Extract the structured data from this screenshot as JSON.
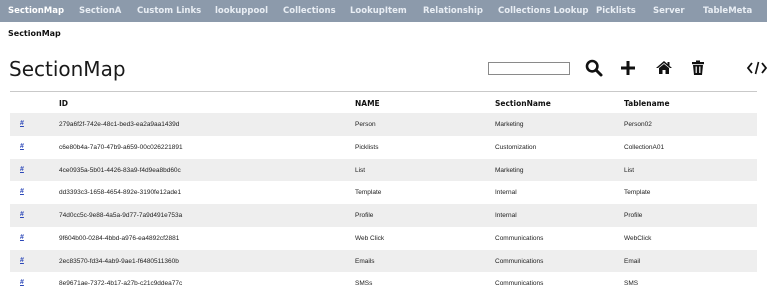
{
  "nav": {
    "items": [
      {
        "label": "SectionMap",
        "active": true
      },
      {
        "label": "SectionA",
        "active": false
      },
      {
        "label": "Custom Links",
        "active": false
      },
      {
        "label": "lookuppool",
        "active": false
      },
      {
        "label": "Collections",
        "active": false
      },
      {
        "label": "LookupItem",
        "active": false
      },
      {
        "label": "Relationship",
        "active": false
      },
      {
        "label": "Collections Lookup",
        "active": false
      },
      {
        "label": "Picklists",
        "active": false
      },
      {
        "label": "Server",
        "active": false
      },
      {
        "label": "TableMeta",
        "active": false
      }
    ]
  },
  "breadcrumb": "SectionMap",
  "page_title": "SectionMap",
  "search": {
    "value": "",
    "placeholder": ""
  },
  "toolbar": {
    "search_icon": "search-icon",
    "add_icon": "plus-icon",
    "home_icon": "home-icon",
    "delete_icon": "trash-icon",
    "code_icon": "code-icon"
  },
  "table": {
    "columns": [
      "",
      "ID",
      "NAME",
      "SectionName",
      "Tablename"
    ],
    "rows": [
      [
        "#",
        "279a6f2f-742e-48c1-bed3-ea2a9aa1439d",
        "Person",
        "Marketing",
        "Person02"
      ],
      [
        "#",
        "c6e80b4a-7a70-47b9-a659-00c026221891",
        "Picklists",
        "Customization",
        "CollectionA01"
      ],
      [
        "#",
        "4ce0935a-5b01-4426-83a9-f4d9ea8bd60c",
        "List",
        "Marketing",
        "List"
      ],
      [
        "#",
        "dd3393c3-1658-4654-892e-3190fe12ade1",
        "Template",
        "Internal",
        "Template"
      ],
      [
        "#",
        "74d0cc5c-9e88-4a5a-9d77-7a9d491e753a",
        "Profile",
        "Internal",
        "Profile"
      ],
      [
        "#",
        "9f604b00-0284-4bbd-a976-ea4892cf2881",
        "Web Click",
        "Communications",
        "WebClick"
      ],
      [
        "#",
        "2ec83570-fd34-4ab9-9ae1-f6480511360b",
        "Emails",
        "Communications",
        "Email"
      ],
      [
        "#",
        "8e9671ae-7372-4b17-a27b-c21c9ddea77c",
        "SMSs",
        "Communications",
        "SMS"
      ]
    ]
  },
  "colors": {
    "nav_bg": "#8c9aab",
    "link": "#2b47b8",
    "row_alt": "#eeeeee"
  }
}
